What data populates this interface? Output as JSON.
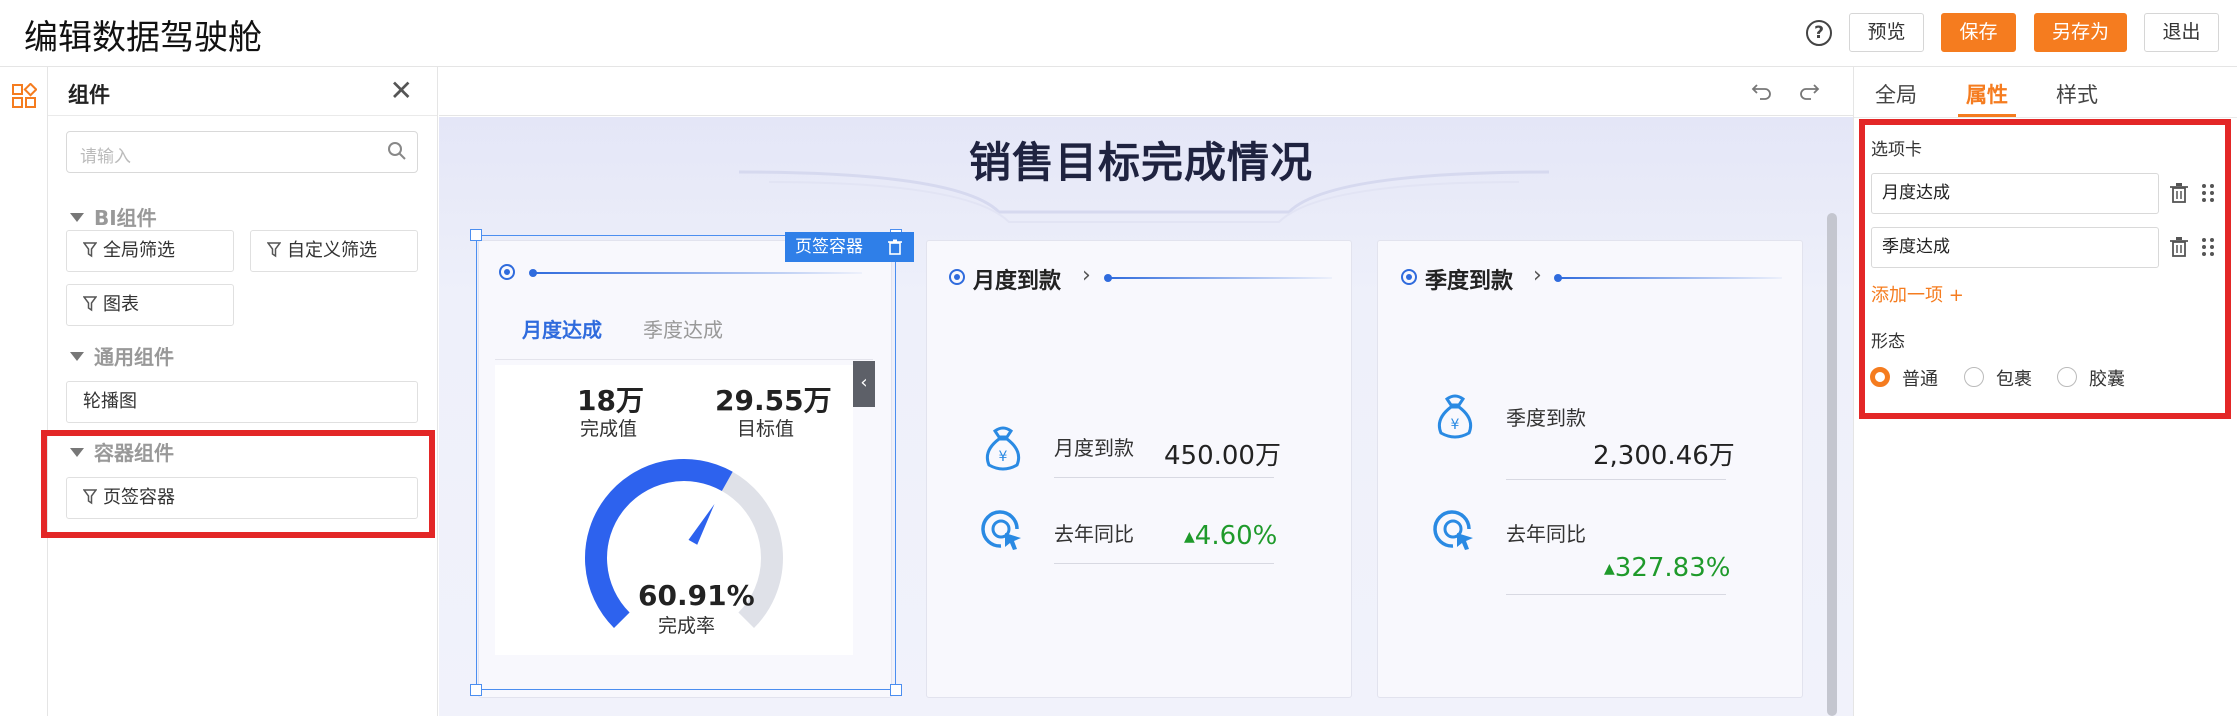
{
  "header": {
    "title": "编辑数据驾驶舱",
    "buttons": {
      "preview": "预览",
      "save": "保存",
      "save_as": "另存为",
      "exit": "退出"
    }
  },
  "left_panel": {
    "title": "组件",
    "search_placeholder": "请输入",
    "sections": [
      {
        "label": "BI组件",
        "items": [
          "全局筛选",
          "自定义筛选",
          "图表"
        ]
      },
      {
        "label": "通用组件",
        "items": [
          "轮播图"
        ]
      },
      {
        "label": "容器组件",
        "items": [
          "页签容器"
        ]
      }
    ]
  },
  "dashboard": {
    "title": "销售目标完成情况",
    "selected_tag": "页签容器",
    "tab_card": {
      "tabs": [
        "月度达成",
        "季度达成"
      ],
      "completed_value": "18万",
      "completed_label": "完成值",
      "target_value": "29.55万",
      "target_label": "目标值",
      "gauge_percent": "60.91%",
      "gauge_fraction": 0.6091,
      "gauge_label": "完成率"
    },
    "monthly_card": {
      "title": "月度到款",
      "metric_label": "月度到款",
      "metric_value": "450.00万",
      "yoy_label": "去年同比",
      "yoy_value": "4.60%"
    },
    "quarterly_card": {
      "title": "季度到款",
      "metric_label": "季度到款",
      "metric_value": "2,300.46万",
      "yoy_label": "去年同比",
      "yoy_value": "327.83%"
    }
  },
  "right_panel": {
    "tabs": [
      "全局",
      "属性",
      "样式"
    ],
    "active_tab": "属性",
    "tabs_label": "选项卡",
    "options": [
      "月度达成",
      "季度达成"
    ],
    "add_item": "添加一项 +",
    "form_label": "形态",
    "form_options": [
      "普通",
      "包裹",
      "胶囊"
    ],
    "selected_form": "普通"
  },
  "colors": {
    "accent": "#f57c1f",
    "blue": "#2f6bdd",
    "highlight_red": "#e32727",
    "green": "#1f9a2b"
  }
}
